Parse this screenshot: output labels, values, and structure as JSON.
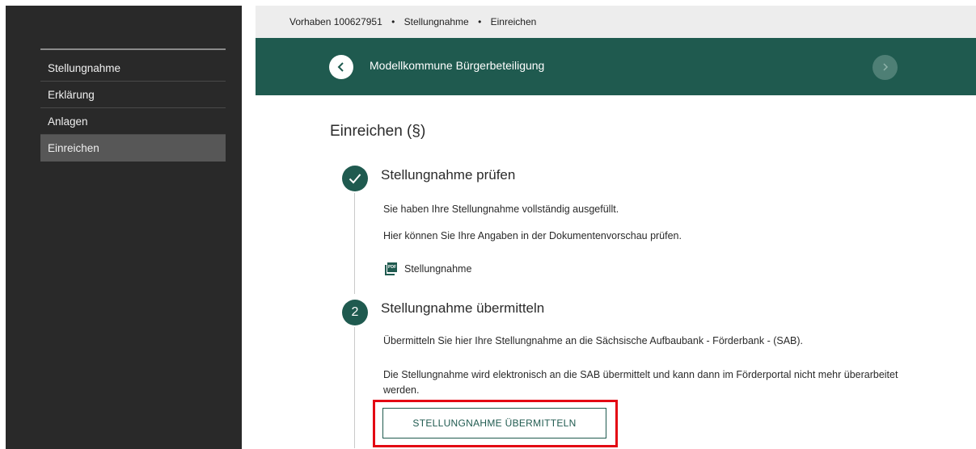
{
  "sidebar": {
    "items": [
      {
        "label": "Stellungnahme"
      },
      {
        "label": "Erklärung"
      },
      {
        "label": "Anlagen"
      },
      {
        "label": "Einreichen"
      }
    ],
    "active_index": 3
  },
  "breadcrumb": {
    "items": [
      "Vorhaben 100627951",
      "Stellungnahme",
      "Einreichen"
    ],
    "separator": "•"
  },
  "banner": {
    "title": "Modellkommune Bürgerbeteiligung",
    "back_icon": "chevron-left-icon",
    "forward_icon": "chevron-right-icon"
  },
  "page": {
    "title": "Einreichen (§)"
  },
  "steps": [
    {
      "marker": "check-icon",
      "title": "Stellungnahme prüfen",
      "lines": [
        "Sie haben Ihre Stellungnahme vollständig ausgefüllt.",
        "Hier können Sie Ihre Angaben in der Dokumentenvorschau prüfen."
      ],
      "document_link": "Stellungnahme",
      "document_icon": "pdf-icon",
      "document_icon_text": "PDF"
    },
    {
      "marker": "2",
      "title": "Stellungnahme übermitteln",
      "lines": [
        "Übermitteln Sie hier Ihre Stellungnahme an die Sächsische Aufbaubank - Förderbank - (SAB).",
        "Die Stellungnahme wird elektronisch an die SAB übermittelt und kann dann im Förderportal nicht mehr überarbeitet werden."
      ],
      "button_label": "STELLUNGNAHME ÜBERMITTELN"
    }
  ],
  "colors": {
    "accent": "#1f5a4f",
    "sidebar_bg": "#292929",
    "highlight": "#e30613"
  }
}
